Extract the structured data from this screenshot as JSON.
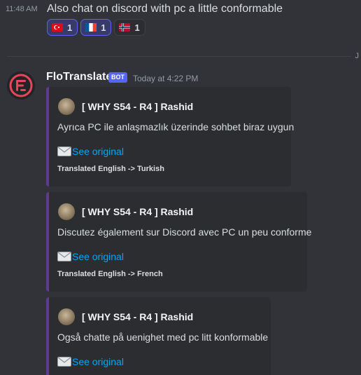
{
  "previous_message": {
    "time": "11:48 AM",
    "text": "Also chat on discord with pc a little conformable",
    "reactions": [
      {
        "flag": "turkey-flag-icon",
        "count": "1"
      },
      {
        "flag": "france-flag-icon",
        "count": "1"
      },
      {
        "flag": "norway-flag-icon",
        "count": "1"
      }
    ]
  },
  "divider": {
    "trailing_text": "J"
  },
  "bot_message": {
    "author": "FloTranslate",
    "tag": "BOT",
    "timestamp": "Today at 4:22 PM",
    "embeds": [
      {
        "author": "[ WHY S54 - R4 ] Rashid",
        "description": "Ayrıca PC ile anlaşmazlık üzerinde sohbet biraz uygun",
        "link_text": "See original",
        "footer": "Translated English -> Turkish"
      },
      {
        "author": "[ WHY S54 - R4 ] Rashid",
        "description": "Discutez également sur Discord avec PC un peu conforme",
        "link_text": "See original",
        "footer": "Translated English -> French"
      },
      {
        "author": "[ WHY S54 - R4 ] Rashid",
        "description": "Også chatte på uenighet med pc litt konformable",
        "link_text": "See original",
        "footer": ""
      }
    ]
  },
  "colors": {
    "background": "#313338",
    "embed_background": "#2b2d31",
    "embed_accent": "#5e3b8f",
    "link": "#00a8fc",
    "bot_tag": "#5865f2",
    "bot_logo": "#e8455a"
  }
}
